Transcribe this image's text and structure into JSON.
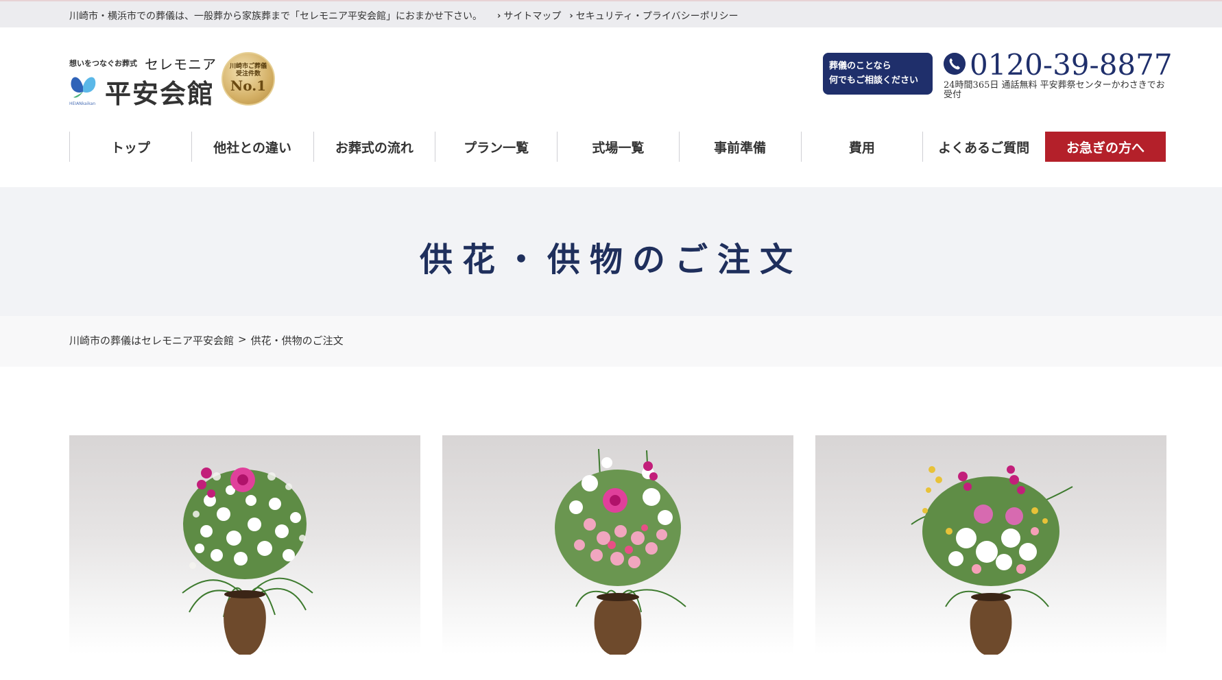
{
  "topbar": {
    "notice": "川崎市・横浜市での葬儀は、一般葬から家族葬まで「セレモニア平安会館」におまかせ下さい。",
    "links": [
      {
        "label": "サイトマップ"
      },
      {
        "label": "セキュリティ・プライバシーポリシー"
      }
    ]
  },
  "header": {
    "tagline": "想いをつなぐお葬式",
    "brand_small": "セレモニア",
    "brand": "平安会館",
    "brand_sub": "HEIANkaikan",
    "medal": {
      "line1": "川崎市ご葬儀",
      "line2": "受注件数",
      "line3": "No.1"
    },
    "consult": {
      "line1": "葬儀のことなら",
      "line2": "何でもご相談ください"
    },
    "phone": "0120-39-8877",
    "phone_note": "24時間365日 通話無料 平安葬祭センターかわさきでお受付",
    "colors": {
      "navy": "#1f2f6b",
      "urgent_red": "#b4202a"
    }
  },
  "nav": {
    "items": [
      {
        "label": "トップ"
      },
      {
        "label": "他社との違い"
      },
      {
        "label": "お葬式の流れ"
      },
      {
        "label": "プラン一覧"
      },
      {
        "label": "式場一覧"
      },
      {
        "label": "事前準備"
      },
      {
        "label": "費用"
      },
      {
        "label": "よくあるご質問"
      }
    ],
    "urgent": "お急ぎの方へ"
  },
  "hero": {
    "title": "供花・供物のご注文"
  },
  "breadcrumb": {
    "home": "川崎市の葬儀はセレモニア平安会館",
    "separator": ">",
    "current": "供花・供物のご注文"
  },
  "products": [
    {
      "image": "flower-arrangement-white"
    },
    {
      "image": "flower-arrangement-pink"
    },
    {
      "image": "flower-arrangement-orchid"
    }
  ]
}
